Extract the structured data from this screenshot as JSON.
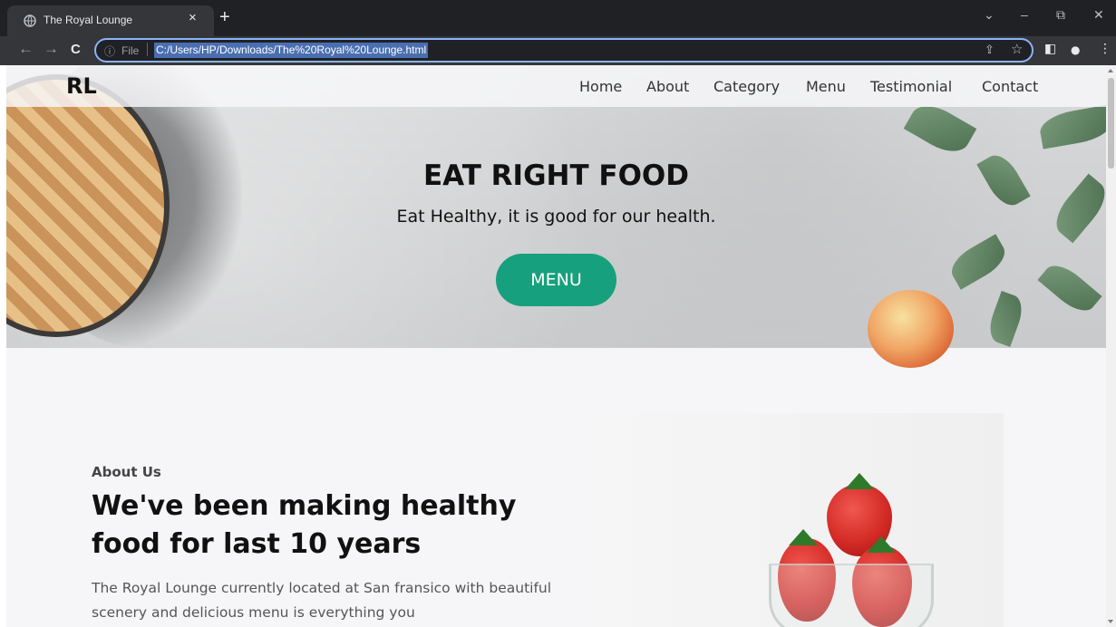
{
  "browser": {
    "tab_title": "The Royal Lounge",
    "tab_close": "×",
    "new_tab": "+",
    "file_label": "File",
    "url": "C:/Users/HP/Downloads/The%20Royal%20Lounge.html",
    "window_controls": {
      "dropdown": "⌄",
      "minimize": "–",
      "restore": "⧉",
      "close": "✕"
    },
    "nav": {
      "back": "←",
      "forward": "→",
      "reload": "C"
    },
    "icons": {
      "info": "ⓘ",
      "share": "⇪",
      "star": "☆",
      "sidepanel": "◧",
      "profile": "●",
      "menu": "⋮"
    }
  },
  "site": {
    "logo": "RL",
    "nav_links": [
      "Home",
      "About",
      "Category",
      "Menu",
      "Testimonial",
      "Contact"
    ],
    "hero": {
      "title": "EAT RIGHT FOOD",
      "subtitle": "Eat Healthy, it is good for our health.",
      "button": "MENU"
    },
    "about": {
      "label": "About Us",
      "heading": "We've been making healthy food for last 10 years",
      "text": "The Royal Lounge currently located at San fransico with beautiful scenery and delicious menu is everything you"
    }
  }
}
